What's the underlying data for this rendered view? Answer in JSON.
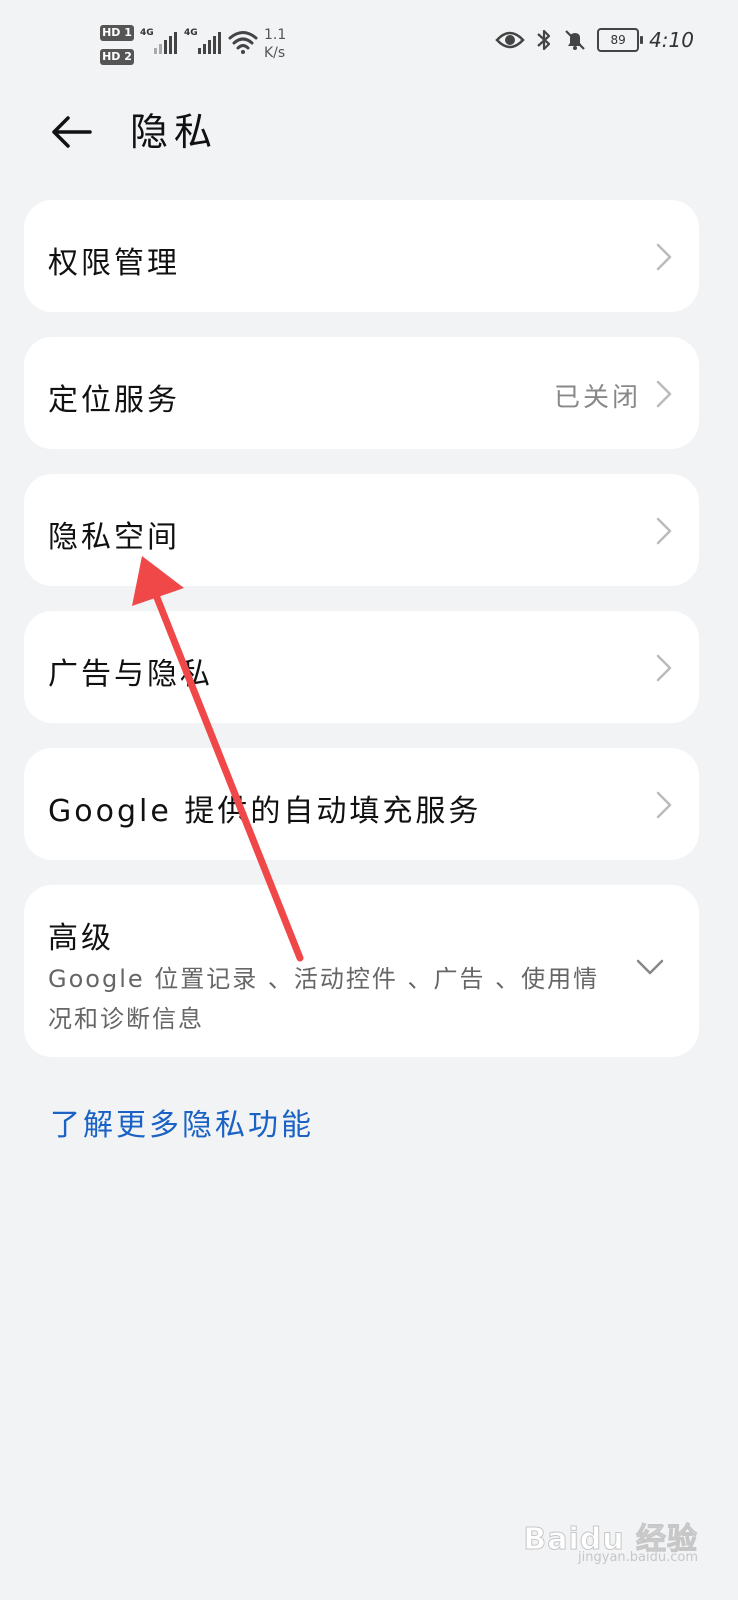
{
  "status_bar": {
    "sim1": "HD 1",
    "sim2": "HD 2",
    "network1": "4G",
    "network2": "4G",
    "speed_value": "1.1",
    "speed_unit": "K/s",
    "battery": "89",
    "time": "4:10",
    "icons": [
      "eye-icon",
      "bluetooth-icon",
      "bell-muted-icon",
      "battery-icon",
      "wifi-icon",
      "signal-icon"
    ]
  },
  "header": {
    "title": "隐私",
    "back_icon": "arrow-left-icon"
  },
  "menu": {
    "permissions": {
      "label": "权限管理"
    },
    "location": {
      "label": "定位服务",
      "value": "已关闭"
    },
    "private_space": {
      "label": "隐私空间"
    },
    "ads_privacy": {
      "label": "广告与隐私"
    },
    "autofill": {
      "label": "Google 提供的自动填充服务"
    },
    "advanced": {
      "label": "高级",
      "desc": "Google 位置记录 、活动控件 、广告 、使用情况和诊断信息"
    }
  },
  "learn_more": "了解更多隐私功能",
  "watermark": {
    "main": "Baidu 经验",
    "sub": "jingyan.baidu.com"
  },
  "colors": {
    "background": "#f1f3f5",
    "card": "#ffffff",
    "link": "#1a62c4",
    "annotation_arrow": "#f04848"
  }
}
